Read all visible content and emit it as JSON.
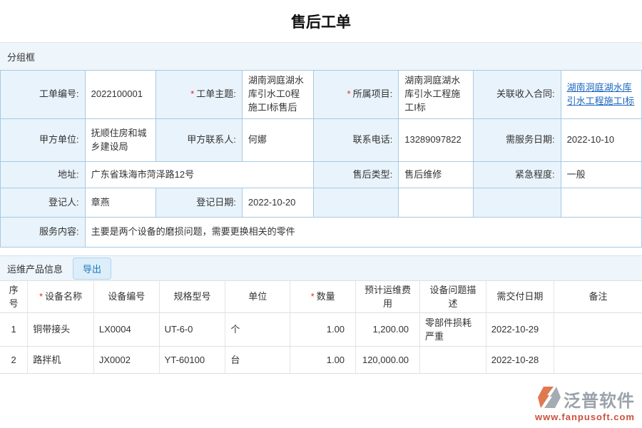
{
  "title": "售后工单",
  "marks": {
    "required": "*"
  },
  "colors": {
    "accent_blue_bg": "#eef5fb",
    "label_bg": "#e9f3fb",
    "form_border": "#a7cae4",
    "link": "#1a66c0",
    "required": "#e02b20",
    "button_text": "#1e78bc",
    "brand_gray": "#9aa2aa",
    "brand_orange": "#e0794f",
    "url_red": "#cb4f3c"
  },
  "group_title": "分组框",
  "form": {
    "order_no": {
      "label": "工单编号:",
      "value": "2022100001"
    },
    "subject": {
      "label": "工单主题:",
      "value": "湖南洞庭湖水库引水工0程施工I标售后"
    },
    "project": {
      "label": "所属项目:",
      "value": "湖南洞庭湖水库引水工程施工I标"
    },
    "income_contract": {
      "label": "关联收入合同:",
      "link_text": "湖南洞庭湖水库引水工程施工I标"
    },
    "party_a_unit": {
      "label": "甲方单位:",
      "value": "抚顺住房和城乡建设局"
    },
    "party_a_contact": {
      "label": "甲方联系人:",
      "value": "何娜"
    },
    "phone": {
      "label": "联系电话:",
      "value": "13289097822"
    },
    "service_date": {
      "label": "需服务日期:",
      "value": "2022-10-10"
    },
    "address": {
      "label": "地址:",
      "value": "广东省珠海市菏泽路12号"
    },
    "aftersale_type": {
      "label": "售后类型:",
      "value": "售后维修"
    },
    "urgency": {
      "label": "紧急程度:",
      "value": "一般"
    },
    "registrant": {
      "label": "登记人:",
      "value": "章燕"
    },
    "register_date": {
      "label": "登记日期:",
      "value": "2022-10-20"
    },
    "service_content": {
      "label": "服务内容:",
      "value": "主要是两个设备的磨损问题，需要更换相关的零件"
    }
  },
  "products": {
    "section_title": "运维产品信息",
    "export_label": "导出",
    "columns": {
      "no": "序号",
      "name": "设备名称",
      "code": "设备编号",
      "model": "规格型号",
      "unit": "单位",
      "qty": "数量",
      "cost": "预计运维费用",
      "issue": "设备问题描述",
      "due": "需交付日期",
      "remark": "备注"
    },
    "rows": [
      {
        "no": "1",
        "name": "铜带接头",
        "code": "LX0004",
        "model": "UT-6-0",
        "unit": "个",
        "qty": "1.00",
        "cost": "1,200.00",
        "issue": "零部件损耗严重",
        "due": "2022-10-29",
        "remark": ""
      },
      {
        "no": "2",
        "name": "路拌机",
        "code": "JX0002",
        "model": "YT-60100",
        "unit": "台",
        "qty": "1.00",
        "cost": "120,000.00",
        "issue": "",
        "due": "2022-10-28",
        "remark": ""
      }
    ]
  },
  "footer": {
    "brand": "泛普软件",
    "url": "www.fanpusoft.com"
  }
}
